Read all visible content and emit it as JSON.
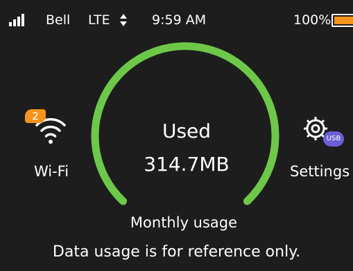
{
  "status_bar": {
    "carrier": "Bell",
    "network": "LTE",
    "time": "9:59 AM",
    "battery_percent": "100%",
    "battery_level": 1.0,
    "icons": [
      "signal-bars-icon",
      "data-arrows-icon",
      "battery-icon"
    ]
  },
  "usage": {
    "used_label": "Used",
    "used_value": "314.7MB",
    "period_label": "Monthly usage"
  },
  "wifi": {
    "label": "Wi-Fi",
    "connected_count": "2",
    "icon": "wifi-icon"
  },
  "settings": {
    "label": "Settings",
    "badge": "USB",
    "icon": "gear-icon"
  },
  "footer": {
    "disclaimer": "Data usage is for reference only."
  },
  "colors": {
    "background": "#1d1d1d",
    "gauge": "#6dc84a",
    "badge_orange": "#f7941d",
    "usb_badge": "#6a5fd6"
  }
}
